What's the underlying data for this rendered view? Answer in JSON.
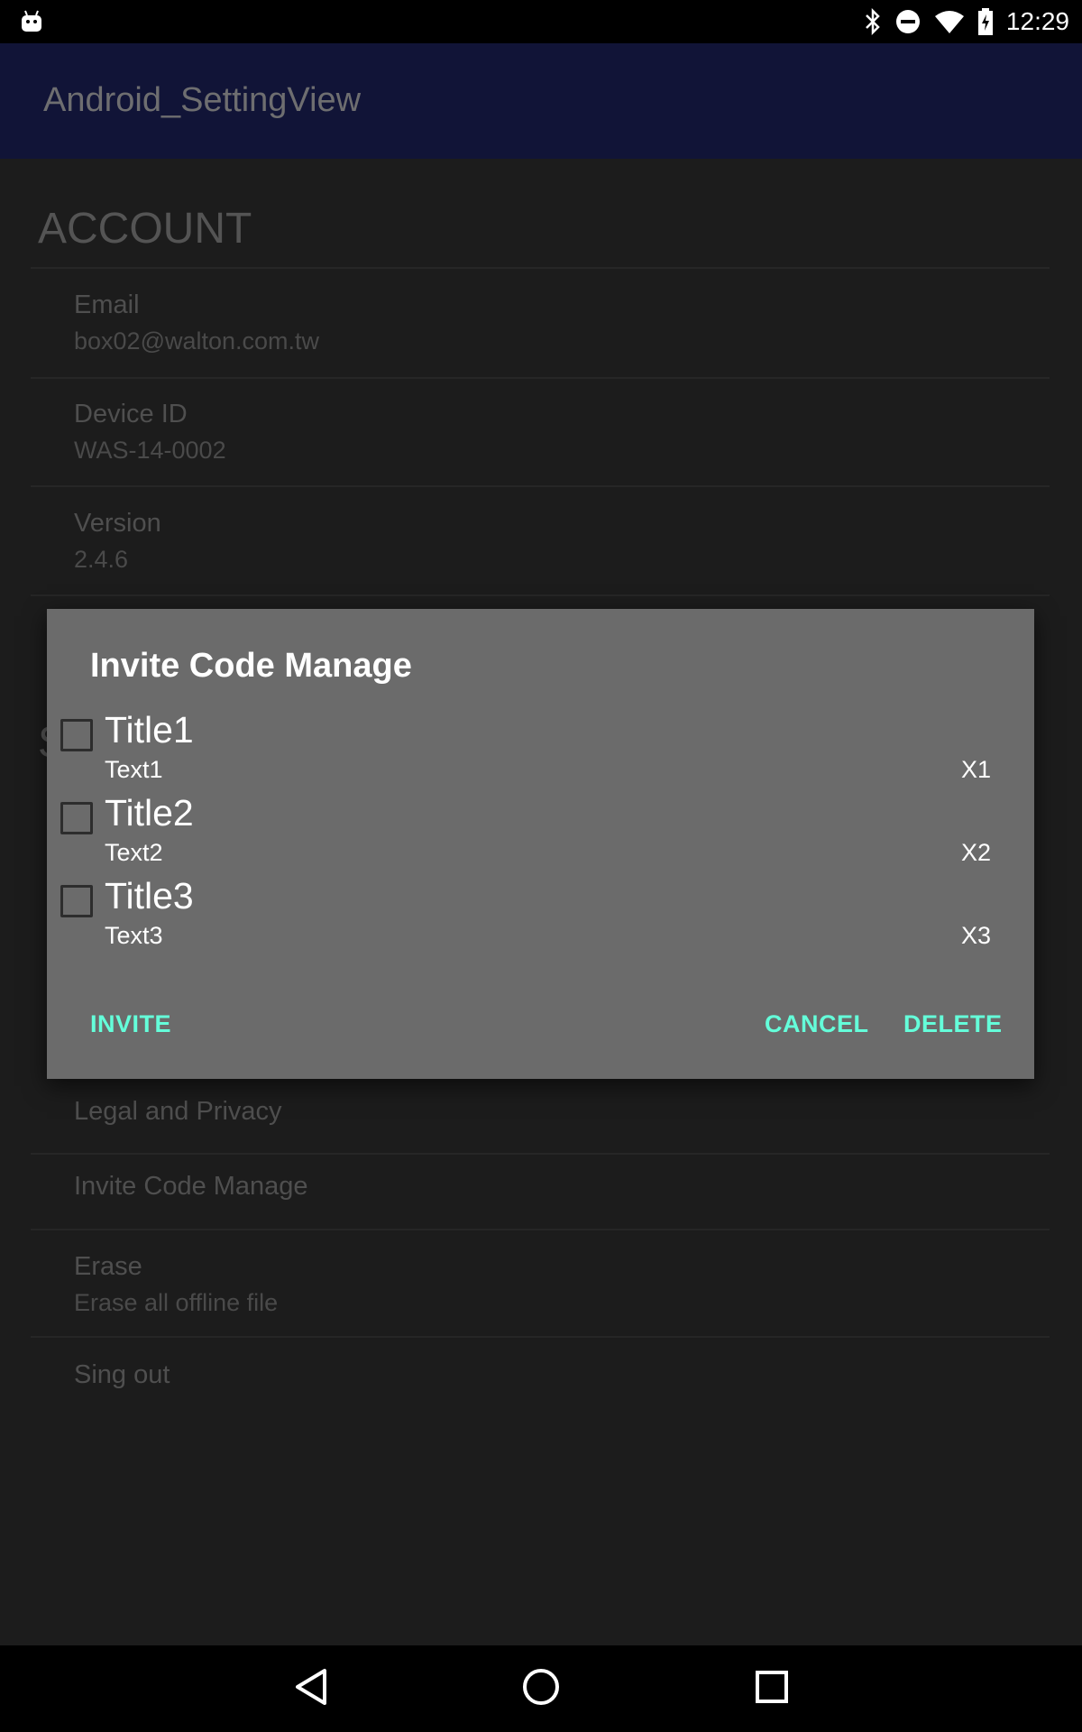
{
  "status_bar": {
    "time": "12:29",
    "icons": [
      "android-icon",
      "bluetooth-icon",
      "do-not-disturb-icon",
      "wifi-icon",
      "battery-charging-icon"
    ]
  },
  "app_bar": {
    "title": "Android_SettingView"
  },
  "settings": {
    "account_header": "ACCOUNT",
    "email": {
      "title": "Email",
      "value": "box02@walton.com.tw"
    },
    "device_id": {
      "title": "Device ID",
      "value": "WAS-14-0002"
    },
    "version": {
      "title": "Version",
      "value": "2.4.6"
    },
    "partial_header_letter": "S",
    "legal": {
      "title": "Legal and Privacy"
    },
    "invite_code": {
      "title": "Invite Code Manage"
    },
    "erase": {
      "title": "Erase",
      "value": "Erase all offline file"
    },
    "sign_out": {
      "title": "Sing out"
    }
  },
  "dialog": {
    "title": "Invite Code Manage",
    "items": [
      {
        "title": "Title1",
        "text": "Text1",
        "code": "X1",
        "checked": false
      },
      {
        "title": "Title2",
        "text": "Text2",
        "code": "X2",
        "checked": false
      },
      {
        "title": "Title3",
        "text": "Text3",
        "code": "X3",
        "checked": false
      }
    ],
    "buttons": {
      "invite": "INVITE",
      "cancel": "CANCEL",
      "delete": "DELETE"
    },
    "accent_color": "#64ffda",
    "background_color": "#6b6b6b"
  },
  "nav_bar": {
    "icons": [
      "back-icon",
      "home-icon",
      "recents-icon"
    ]
  }
}
